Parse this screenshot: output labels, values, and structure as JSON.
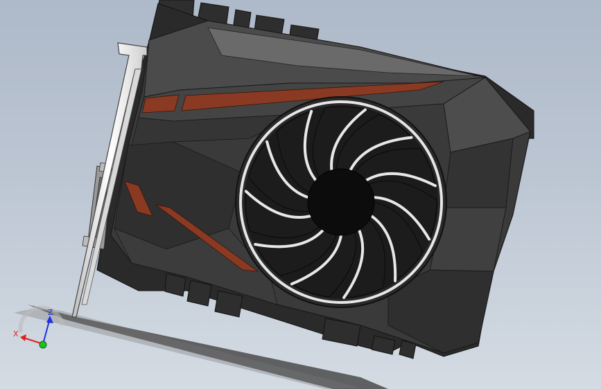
{
  "viewport": {
    "background_top": "#aeb9c9",
    "background_bottom": "#d4dbe3"
  },
  "model": {
    "shroud_color": "#3a3a3a",
    "shroud_dark": "#262626",
    "shroud_light": "#5a5a5a",
    "accent_color": "#8a3a22",
    "fan_blade_color": "#1c1c1c",
    "fan_edge_color": "#e8e8e8",
    "bracket_color": "#f2f2f2"
  },
  "triad": {
    "x_label": "X",
    "z_label": "Z",
    "x_color": "#e02020",
    "z_color": "#2030e0",
    "y_color": "#20c020"
  }
}
